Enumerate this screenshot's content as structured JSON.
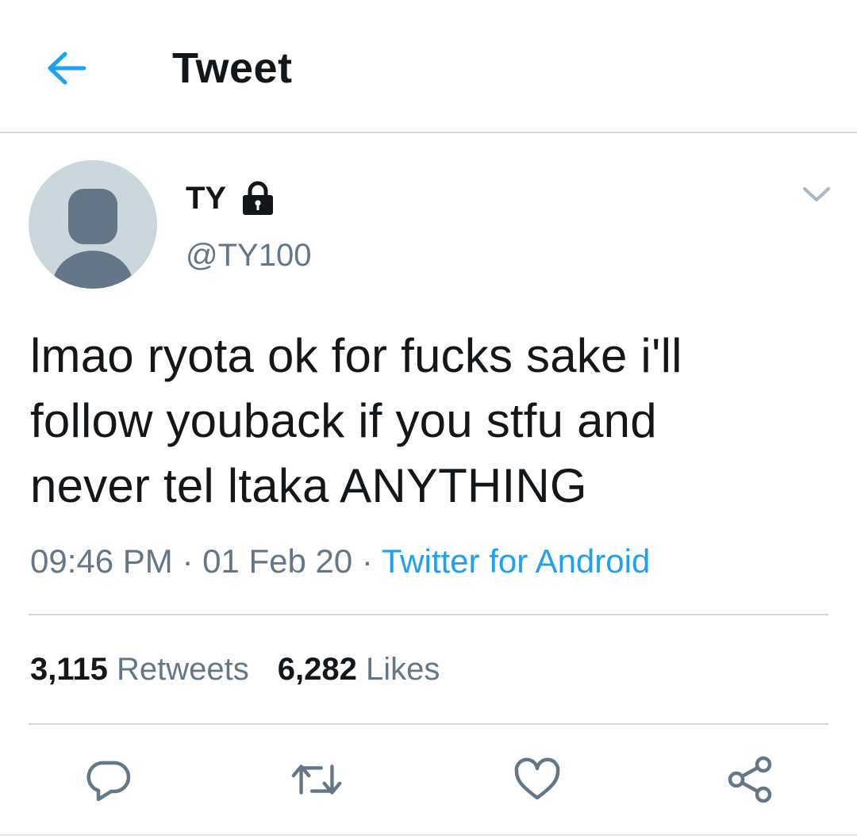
{
  "header": {
    "title": "Tweet",
    "back_icon": "back-arrow-icon"
  },
  "tweet": {
    "author": {
      "display_name": "TY",
      "handle": "@TY100",
      "protected": true
    },
    "text_lines": [
      "lmao ryota ok for fucks sake i'll",
      "follow youback if you stfu and",
      "never tel ltaka ANYTHING"
    ],
    "time": "09:46 PM",
    "separator": " · ",
    "date": "01 Feb 20",
    "source": "Twitter for Android"
  },
  "stats": {
    "retweets_count": "3,115",
    "retweets_label": "Retweets",
    "likes_count": "6,282",
    "likes_label": "Likes"
  },
  "actions": [
    "reply-icon",
    "retweet-icon",
    "like-icon",
    "share-icon"
  ],
  "colors": {
    "accent": "#1da1f2",
    "text": "#14171a",
    "secondary": "#657786",
    "divider": "#ccd6dd",
    "avatar_bg": "#ccd6dd",
    "avatar_fg": "#657786"
  }
}
